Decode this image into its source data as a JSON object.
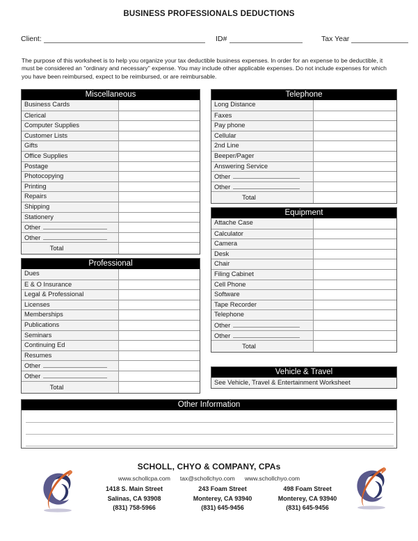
{
  "document": {
    "title": "BUSINESS PROFESSIONALS DEDUCTIONS",
    "purpose": "The purpose of this worksheet is to help you organize your tax deductible business expenses.  In order for an expense to be deductible, it must be considered an \"ordinary and necessary\" expense.  You may include other applicable expenses.  Do not include expenses for which you have been reimbursed, expect to be reimbursed, or are reimbursable."
  },
  "header_fields": {
    "client_label": "Client:",
    "client_value": "",
    "id_label": "ID#",
    "id_value": "",
    "tax_year_label": "Tax Year",
    "tax_year_value": ""
  },
  "labels": {
    "other": "Other",
    "total": "Total"
  },
  "sections": {
    "miscellaneous": {
      "title": "Miscellaneous",
      "items": [
        "Business Cards",
        "Clerical",
        "Computer Supplies",
        "Customer Lists",
        "Gifts",
        "Office Supplies",
        "Postage",
        "Photocopying",
        "Printing",
        "Repairs",
        "Shipping",
        "Stationery"
      ],
      "other_rows": 2,
      "total_label": "Total"
    },
    "professional": {
      "title": "Professional",
      "items": [
        "Dues",
        "E & O Insurance",
        "Legal & Professional",
        "Licenses",
        "Memberships",
        "Publications",
        "Seminars",
        "Continuing Ed",
        "Resumes"
      ],
      "other_rows": 2,
      "total_label": "Total"
    },
    "telephone": {
      "title": "Telephone",
      "items": [
        "Long Distance",
        "Faxes",
        "Pay phone",
        "Cellular",
        "2nd Line",
        "Beeper/Pager",
        "Answering Service"
      ],
      "other_rows": 2,
      "total_label": "Total"
    },
    "equipment": {
      "title": "Equipment",
      "items": [
        "Attache Case",
        "Calculator",
        "Camera",
        "Desk",
        "Chair",
        "Filing Cabinet",
        "Cell Phone",
        "Software",
        "Tape Recorder",
        "Telephone"
      ],
      "other_rows": 2,
      "total_label": "Total"
    },
    "vehicle_travel": {
      "title": "Vehicle & Travel",
      "note": "See Vehicle, Travel & Entertainment Worksheet"
    },
    "other_information": {
      "title": "Other Information",
      "lines": 3
    }
  },
  "footer": {
    "firm_name": "SCHOLL, CHYO & COMPANY, CPAs",
    "web_links": [
      "www.schollcpa.com",
      "tax@schollchyo.com",
      "www.schollchyo.com"
    ],
    "offices": [
      {
        "street": "1418 S. Main Street",
        "city": "Salinas, CA 93908",
        "phone": "(831) 758-5966"
      },
      {
        "street": "243 Foam Street",
        "city": "Monterey, CA 93940",
        "phone": "(831) 645-9456"
      },
      {
        "street": "498 Foam Street",
        "city": "Monterey, CA 93940",
        "phone": "(831) 645-9456"
      }
    ],
    "logo_name": "scholl-chyo-c-logo"
  },
  "colors": {
    "header_bar": "#000000",
    "header_text": "#ffffff",
    "label_cell": "#f2f2f2",
    "rule": "#9a9a9a",
    "logo_purple": "#5b5a8c",
    "logo_navy": "#2e3566",
    "logo_orange": "#d4622a"
  }
}
